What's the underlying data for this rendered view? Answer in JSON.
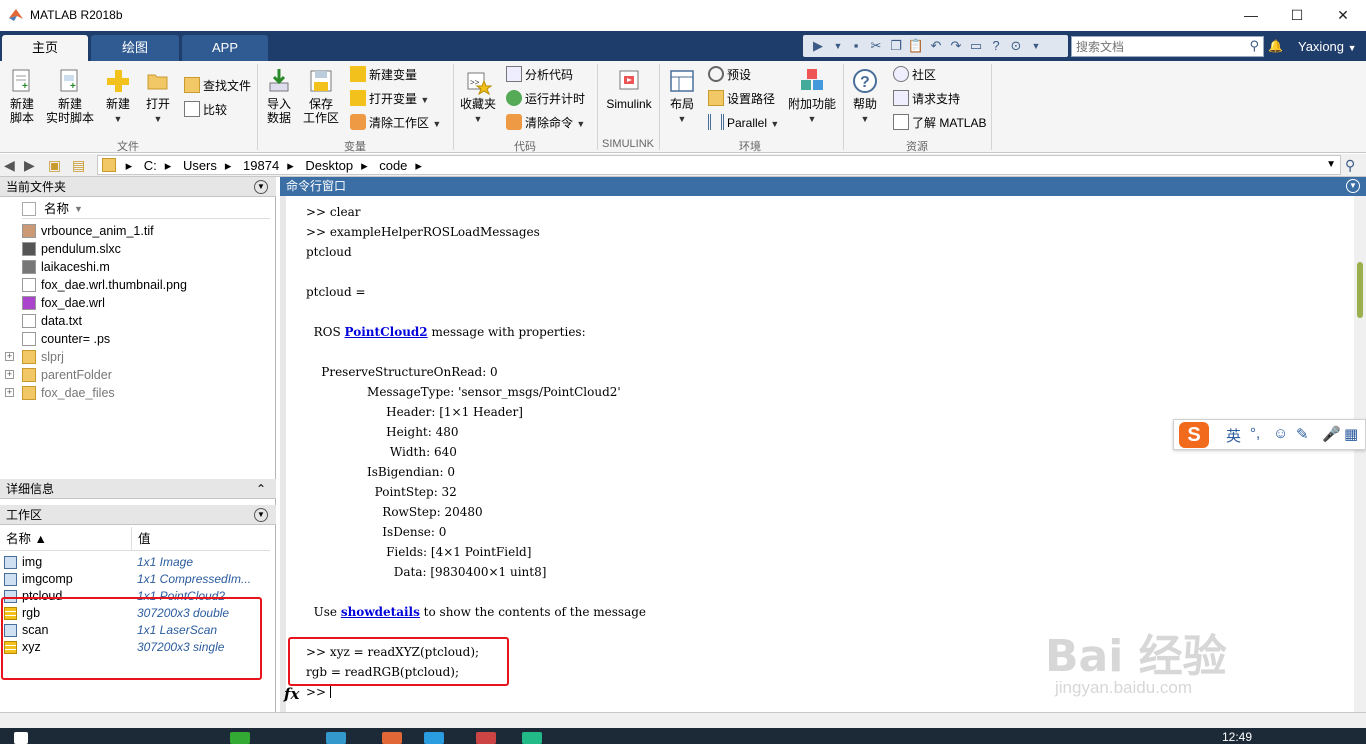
{
  "window": {
    "title": "MATLAB R2018b",
    "minimize": "—",
    "maximize": "☐",
    "close": "✕"
  },
  "tabs": [
    "主页",
    "绘图",
    "APP"
  ],
  "search": {
    "placeholder": "搜索文档"
  },
  "user": {
    "name": "Yaxiong"
  },
  "ribbon": {
    "file": {
      "new_script": "新建\n脚本",
      "new_live_script": "新建\n实时脚本",
      "new": "新建",
      "open": "打开",
      "find_files": "查找文件",
      "compare": "比较",
      "group": "文件"
    },
    "variable": {
      "import": "导入\n数据",
      "save_workspace": "保存\n工作区",
      "new_variable": "新建变量",
      "open_variable": "打开变量",
      "clear_workspace": "清除工作区",
      "group": "变量"
    },
    "code": {
      "favorites": "收藏夹",
      "analyze": "分析代码",
      "run_time": "运行并计时",
      "clear_commands": "清除命令",
      "group": "代码"
    },
    "simulink": {
      "simulink": "Simulink",
      "group": "SIMULINK"
    },
    "environment": {
      "layout": "布局",
      "preferences": "预设",
      "set_path": "设置路径",
      "parallel": "Parallel",
      "addons": "附加功能",
      "group": "环境"
    },
    "resources": {
      "help": "帮助",
      "community": "社区",
      "request_support": "请求支持",
      "learn": "了解 MATLAB",
      "group": "资源"
    }
  },
  "path": [
    "C:",
    "Users",
    "19874",
    "Desktop",
    "code"
  ],
  "current_folder": {
    "title": "当前文件夹",
    "column": "名称",
    "files": [
      {
        "name": "vrbounce_anim_1.tif",
        "type": "image"
      },
      {
        "name": "pendulum.slxc",
        "type": "slxc"
      },
      {
        "name": "laikaceshi.m",
        "type": "m"
      },
      {
        "name": "fox_dae.wrl.thumbnail.png",
        "type": "png"
      },
      {
        "name": "fox_dae.wrl",
        "type": "wrl"
      },
      {
        "name": "data.txt",
        "type": "txt"
      },
      {
        "name": "counter= .ps",
        "type": "ps"
      },
      {
        "name": "slprj",
        "type": "folder"
      },
      {
        "name": "parentFolder",
        "type": "folder"
      },
      {
        "name": "fox_dae_files",
        "type": "folder"
      }
    ]
  },
  "details": {
    "title": "详细信息"
  },
  "workspace": {
    "title": "工作区",
    "col_name": "名称 ▲",
    "col_value": "值",
    "vars": [
      {
        "name": "img",
        "value": "1x1 Image",
        "kind": "object"
      },
      {
        "name": "imgcomp",
        "value": "1x1 CompressedIm...",
        "kind": "object"
      },
      {
        "name": "ptcloud",
        "value": "1x1 PointCloud2",
        "kind": "object"
      },
      {
        "name": "rgb",
        "value": "307200x3 double",
        "kind": "matrix"
      },
      {
        "name": "scan",
        "value": "1x1 LaserScan",
        "kind": "object"
      },
      {
        "name": "xyz",
        "value": "307200x3 single",
        "kind": "matrix"
      }
    ]
  },
  "command_window": {
    "title": "命令行窗口",
    "lines": [
      ">> clear",
      ">> exampleHelperROSLoadMessages",
      "ptcloud",
      "",
      "ptcloud =",
      "",
      "  ROS |PointCloud2| message with properties:",
      "",
      "    PreserveStructureOnRead: 0",
      "                MessageType: 'sensor_msgs/PointCloud2'",
      "                     Header: [1×1 Header]",
      "                     Height: 480",
      "                      Width: 640",
      "                IsBigendian: 0",
      "                  PointStep: 32",
      "                    RowStep: 20480",
      "                    IsDense: 0",
      "                     Fields: [4×1 PointField]",
      "                       Data: [9830400×1 uint8]",
      "",
      "  Use |showdetails| to show the contents of the message",
      "",
      ">> xyz = readXYZ(ptcloud);",
      "rgb = readRGB(ptcloud);"
    ],
    "prompt": ">> ",
    "fx": "fx"
  },
  "ime": {
    "lang": "英",
    "punct": "°,"
  },
  "watermark": {
    "brand": "Bai 经验",
    "url": "jingyan.baidu.com"
  },
  "taskbar": {
    "time": "12:49"
  },
  "colors": {
    "accent": "#1f3d6b",
    "highlight": "#e8141b",
    "link": "#0000dd"
  }
}
